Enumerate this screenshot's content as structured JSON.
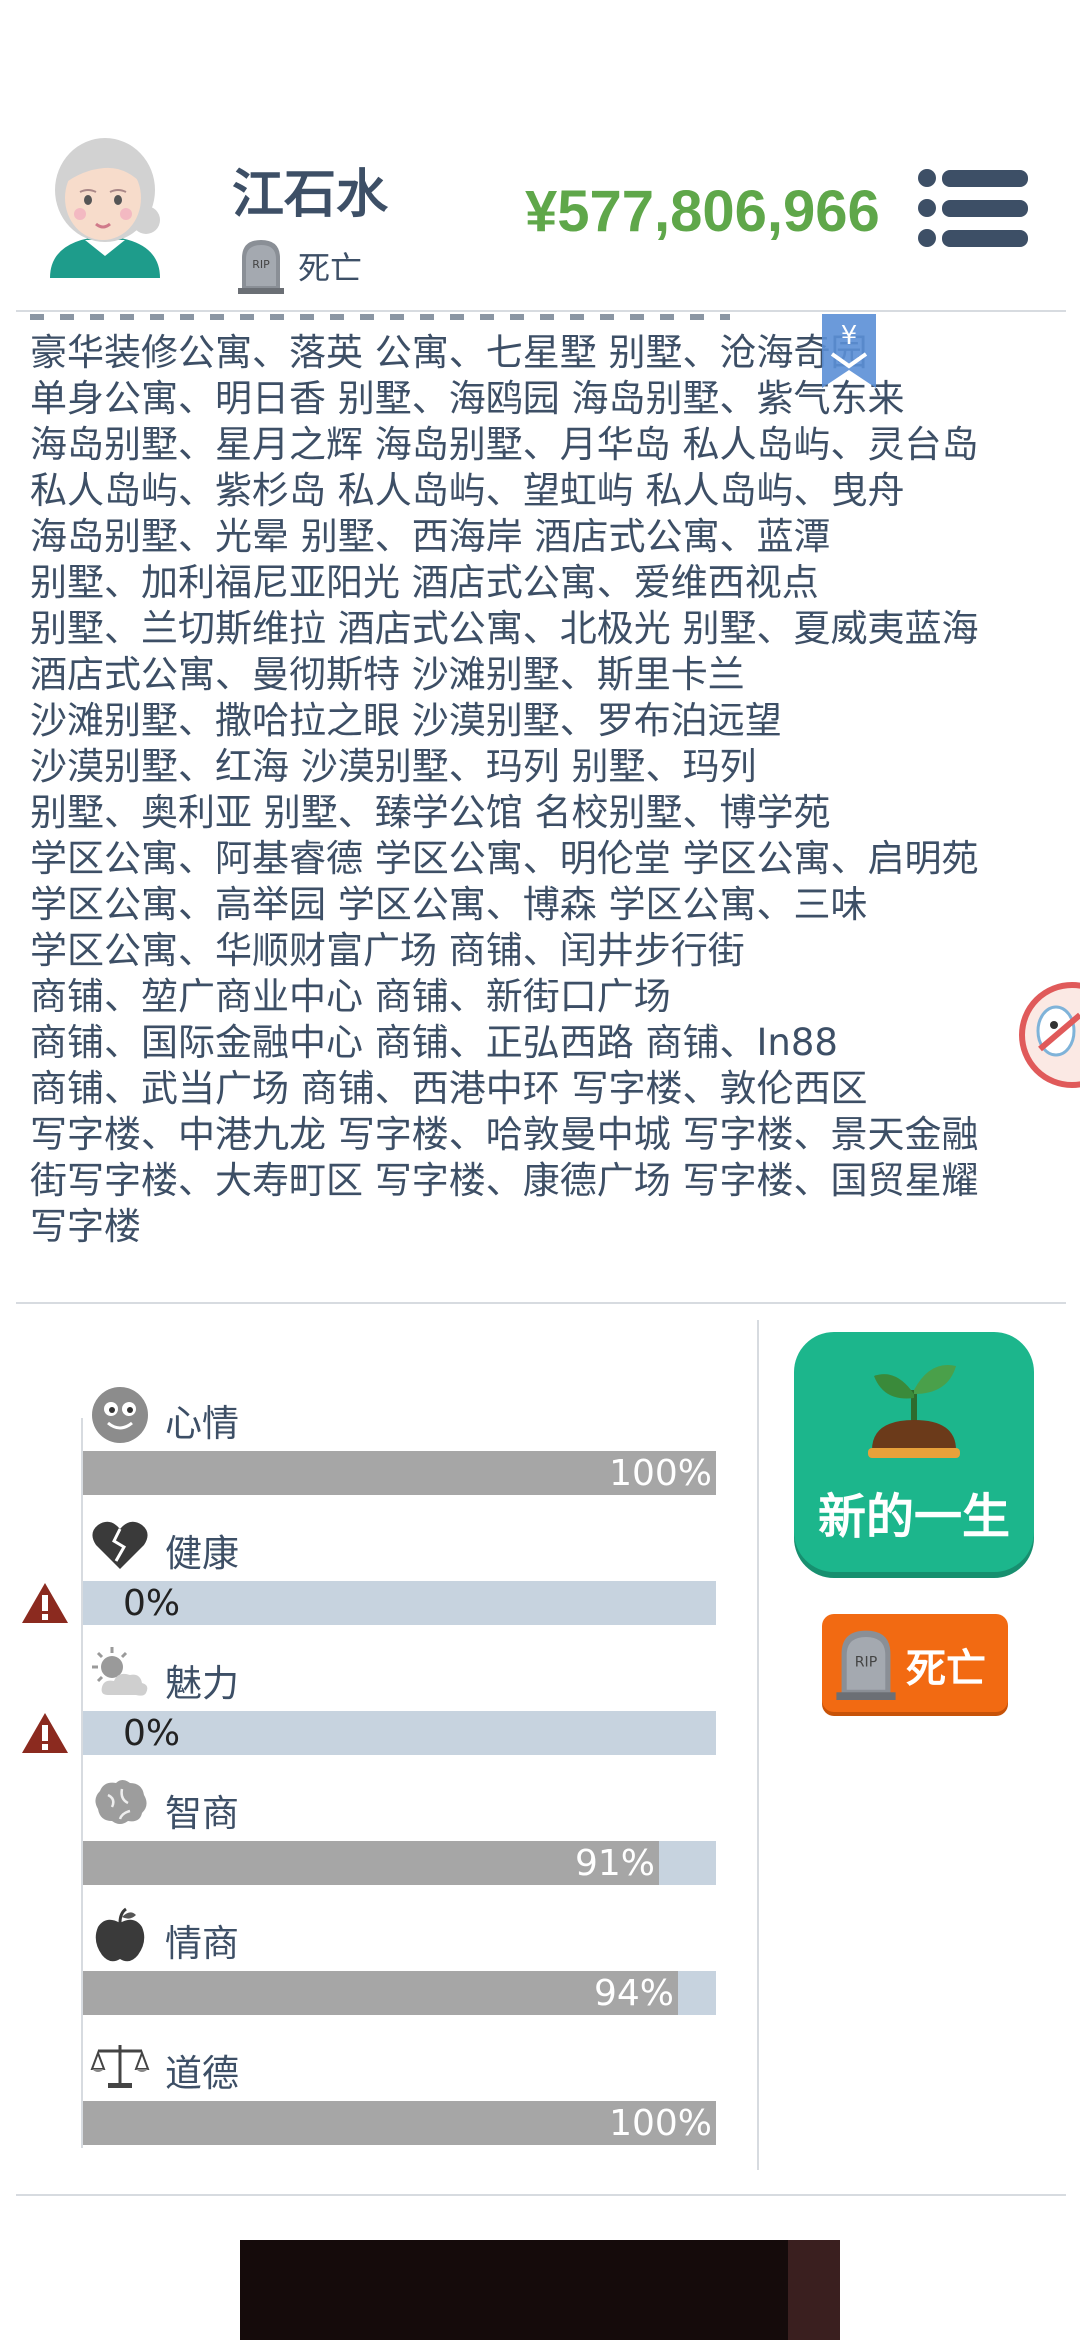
{
  "header": {
    "name": "江石水",
    "status": "死亡",
    "money": "¥577,806,966",
    "icons": {
      "avatar": "grandma-avatar",
      "status": "tombstone-icon",
      "menu": "menu-icon"
    }
  },
  "assets": {
    "lines": [
      "豪华装修公寓、落英 公寓、七星墅 别墅、沧海奇园",
      "单身公寓、明日香 别墅、海鸥园 海岛别墅、紫气东来",
      "海岛别墅、星月之辉 海岛别墅、月华岛 私人岛屿、灵台岛",
      "私人岛屿、紫杉岛 私人岛屿、望虹屿 私人岛屿、曳舟",
      "海岛别墅、光晕 别墅、西海岸 酒店式公寓、蓝潭",
      "别墅、加利福尼亚阳光 酒店式公寓、爱维西视点",
      "别墅、兰切斯维拉 酒店式公寓、北极光 别墅、夏威夷蓝海",
      "酒店式公寓、曼彻斯特 沙滩别墅、斯里卡兰",
      "沙滩别墅、撒哈拉之眼 沙漠别墅、罗布泊远望",
      "沙漠别墅、红海 沙漠别墅、玛列 别墅、玛列",
      "别墅、奥利亚 别墅、臻学公馆 名校别墅、博学苑",
      "学区公寓、阿基睿德 学区公寓、明伦堂 学区公寓、启明苑",
      "学区公寓、高举园 学区公寓、博森 学区公寓、三味",
      "学区公寓、华顺财富广场 商铺、闰井步行街",
      "商铺、堃广商业中心 商铺、新街口广场",
      "商铺、国际金融中心 商铺、正弘西路 商铺、In88",
      "商铺、武当广场 商铺、西港中环 写字楼、敦伦西区",
      "写字楼、中港九龙 写字楼、哈敦曼中城 写字楼、景天金融",
      "街写字楼、大寿町区 写字楼、康德广场 写字楼、国贸星耀",
      "写字楼"
    ],
    "bookmark_symbol": "¥"
  },
  "stats": [
    {
      "label": "心情",
      "icon": "smiley-face-icon",
      "value": 100,
      "display": "100%",
      "warning": false
    },
    {
      "label": "健康",
      "icon": "broken-heart-icon",
      "value": 0,
      "display": "0%",
      "warning": true
    },
    {
      "label": "魅力",
      "icon": "sun-cloud-icon",
      "value": 0,
      "display": "0%",
      "warning": true
    },
    {
      "label": "智商",
      "icon": "brain-icon",
      "value": 91,
      "display": "91%",
      "warning": false
    },
    {
      "label": "情商",
      "icon": "apple-icon",
      "value": 94,
      "display": "94%",
      "warning": false
    },
    {
      "label": "道德",
      "icon": "balance-scale-icon",
      "value": 100,
      "display": "100%",
      "warning": false
    }
  ],
  "actions": {
    "new_life": "新的一生",
    "death": "死亡"
  },
  "colors": {
    "money": "#5fa74a",
    "text": "#3d4f66",
    "bar_fill": "#a6a6a6",
    "bar_track": "#c7d3df",
    "new_life": "#1cb68c",
    "death_button": "#f26a12"
  }
}
